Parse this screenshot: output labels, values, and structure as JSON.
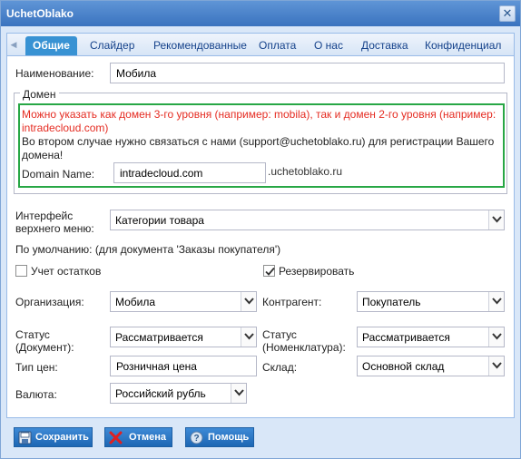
{
  "window": {
    "title": "UchetOblako",
    "close_label": "✕"
  },
  "tabs": [
    {
      "label": "Общие",
      "active": true
    },
    {
      "label": "Слайдер"
    },
    {
      "label": "Рекомендованные"
    },
    {
      "label": "Оплата"
    },
    {
      "label": "О нас"
    },
    {
      "label": "Доставка"
    },
    {
      "label": "Конфиденциал"
    }
  ],
  "form": {
    "name_label": "Наименование:",
    "name_value": "Мобила",
    "domain_legend": "Домен",
    "domain_warning": "Можно указать как домен 3-го уровня (например: mobila), так и домен 2-го уровня (например: intradecloud.com)",
    "domain_note": "Во втором случае нужно связаться с нами (support@uchetoblako.ru) для регистрации Вашего домена!",
    "domain_name_label": "Domain Name:",
    "domain_name_value": "intradecloud.com",
    "domain_suffix": ".uchetoblako.ru",
    "menu_label_1": "Интерфейс",
    "menu_label_2": "верхнего меню:",
    "menu_value": "Категории товара",
    "default_caption": "По умолчанию: (для документа 'Заказы покупателя')",
    "stock_label": "Учет остатков",
    "stock_checked": false,
    "reserve_label": "Резервировать",
    "reserve_checked": true,
    "org_label": "Организация:",
    "org_value": "Мобила",
    "counterparty_label": "Контрагент:",
    "counterparty_value": "Покупатель",
    "status_doc_label_1": "Статус",
    "status_doc_label_2": "(Документ):",
    "status_doc_value": "Рассматривается",
    "status_nom_label_1": "Статус",
    "status_nom_label_2": "(Номенклатура):",
    "status_nom_value": "Рассматривается",
    "price_type_label": "Тип цен:",
    "price_type_value": "Розничная цена",
    "warehouse_label": "Склад:",
    "warehouse_value": "Основной склад",
    "currency_label": "Валюта:",
    "currency_value": "Российский рубль"
  },
  "buttons": {
    "save": "Сохранить",
    "cancel": "Отмена",
    "help": "Помощь"
  },
  "colors": {
    "accent": "#3892d3",
    "warning_text": "#e52c22",
    "domain_border": "#28a745"
  }
}
